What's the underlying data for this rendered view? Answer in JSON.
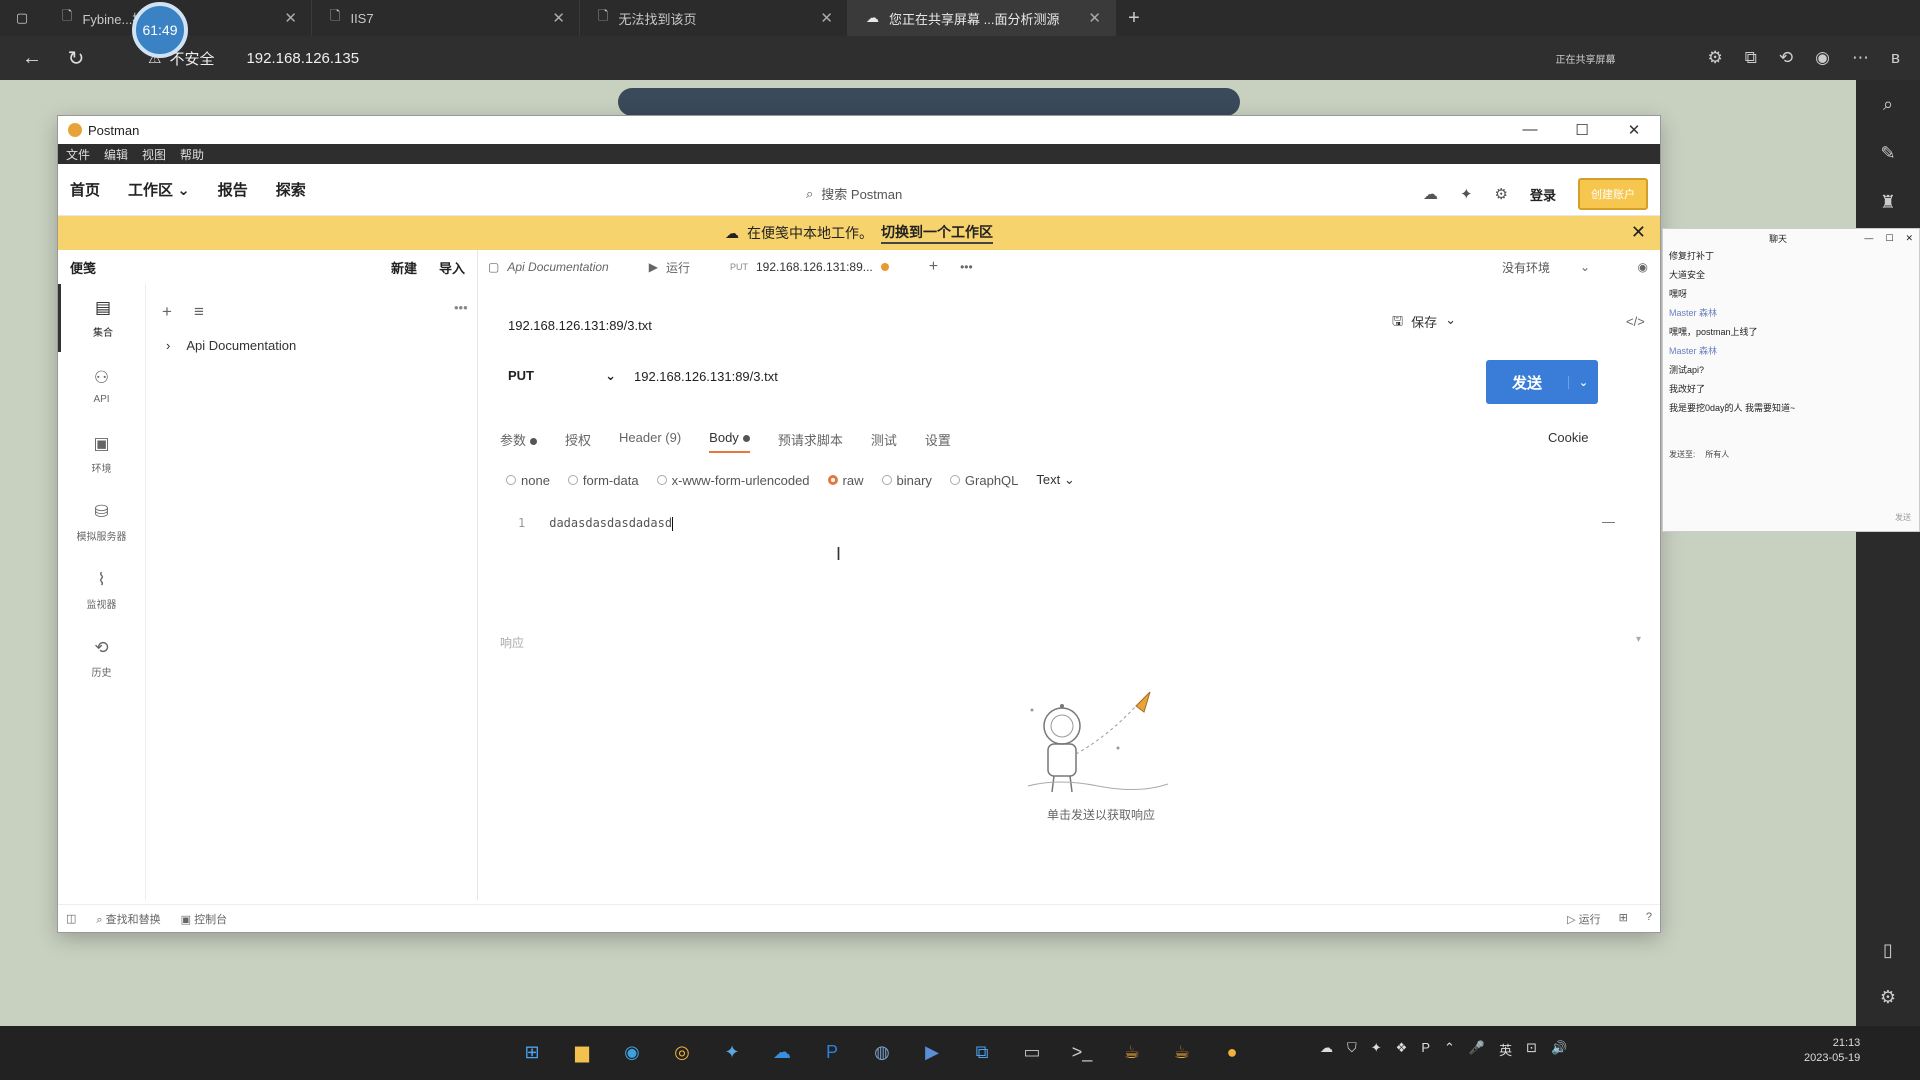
{
  "browser": {
    "tabs": [
      {
        "title": "Fybine...操系统",
        "active": false
      },
      {
        "title": "IIS7",
        "active": false
      },
      {
        "title": "无法找到该页",
        "active": false
      },
      {
        "title": "您正在共享屏幕 ...面分析测源",
        "active": true
      }
    ],
    "timer": "61:49",
    "security_label": "不安全",
    "url": "192.168.126.135",
    "share_note": "正在共享屏幕"
  },
  "postman": {
    "title": "Postman",
    "menu": [
      "文件",
      "编辑",
      "视图",
      "帮助"
    ],
    "nav": [
      "首页",
      "工作区",
      "报告",
      "探索"
    ],
    "search_placeholder": "搜索 Postman",
    "login": "登录",
    "signup": "创建账户",
    "banner_text": "在便笺中本地工作。",
    "banner_link": "切换到一个工作区",
    "sidebar": {
      "title": "便笺",
      "new": "新建",
      "import": "导入",
      "rail": [
        "集合",
        "API",
        "环境",
        "模拟服务器",
        "监视器",
        "历史"
      ],
      "collection": "Api Documentation"
    },
    "work_tabs": {
      "tab1": "Api Documentation",
      "tab2": "运行",
      "tab3_method": "PUT",
      "tab3": "192.168.126.131:89..."
    },
    "environment": "没有环境",
    "request": {
      "title": "192.168.126.131:89/3.txt",
      "save": "保存",
      "method": "PUT",
      "url": "192.168.126.131:89/3.txt",
      "send": "发送",
      "tabs": [
        "参数",
        "授权",
        "Header (9)",
        "Body",
        "预请求脚本",
        "测试",
        "设置"
      ],
      "cookie": "Cookie",
      "body_types": [
        "none",
        "form-data",
        "x-www-form-urlencoded",
        "raw",
        "binary",
        "GraphQL"
      ],
      "body_format": "Text",
      "body_line": "1",
      "body_text": "dadasdasdasdadasd"
    },
    "response_label": "响应",
    "response_hint": "单击发送以获取响应",
    "status": {
      "find_replace": "查找和替换",
      "console": "控制台",
      "runner": "运行"
    }
  },
  "chat": {
    "title": "聊天",
    "messages": [
      {
        "text": "修复打补丁",
        "meta": false
      },
      {
        "text": "大道安全",
        "meta": false
      },
      {
        "text": "嘿呀",
        "meta": false
      },
      {
        "text": "Master 森林",
        "meta": true
      },
      {
        "text": "嘿嘿，postman上线了",
        "meta": false
      },
      {
        "text": "Master 森林",
        "meta": true
      },
      {
        "text": "测试api?",
        "meta": false
      },
      {
        "text": "我改好了",
        "meta": false
      },
      {
        "text": "我是要挖0day的人 我需要知道~",
        "meta": false
      }
    ],
    "send_to_label": "发送至:",
    "send_to_value": "所有人",
    "send_button": "发送"
  },
  "taskbar": {
    "time": "21:13",
    "date": "2023-05-19",
    "lang": "英"
  }
}
